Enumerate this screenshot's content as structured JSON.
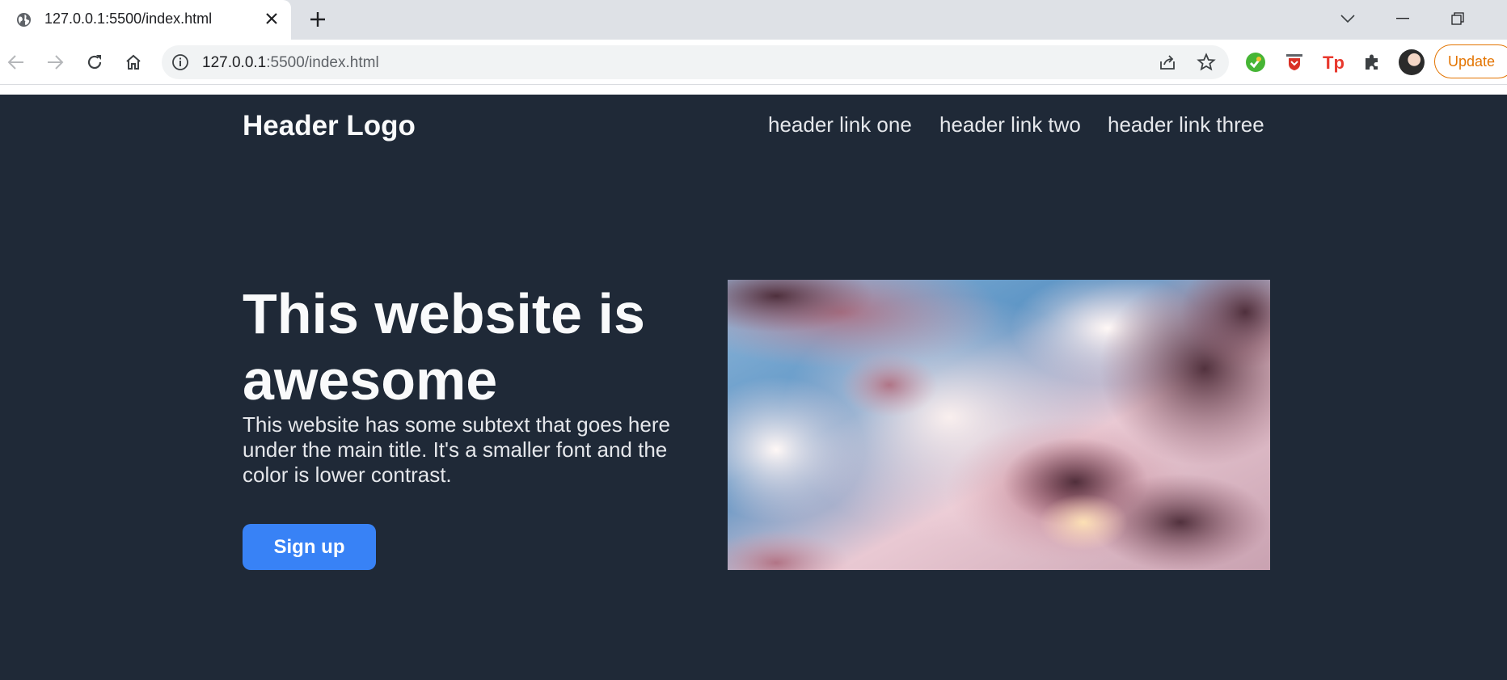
{
  "browser": {
    "tab_title": "127.0.0.1:5500/index.html",
    "url_host": "127.0.0.1",
    "url_rest": ":5500/index.html",
    "update_label": "Update",
    "accent": "#e37400"
  },
  "site": {
    "logo": "Header Logo",
    "nav": [
      "header link one",
      "header link two",
      "header link three"
    ],
    "hero": {
      "title_line1": "This website is",
      "title_line2": "awesome",
      "subtext": "This website has some subtext that goes here under the main title. It's a smaller font and the color is lower contrast.",
      "signup_label": "Sign up"
    },
    "colors": {
      "background": "#1f2937",
      "heading": "#f9fafb",
      "text": "#e5e7eb",
      "button": "#3882f6"
    }
  }
}
